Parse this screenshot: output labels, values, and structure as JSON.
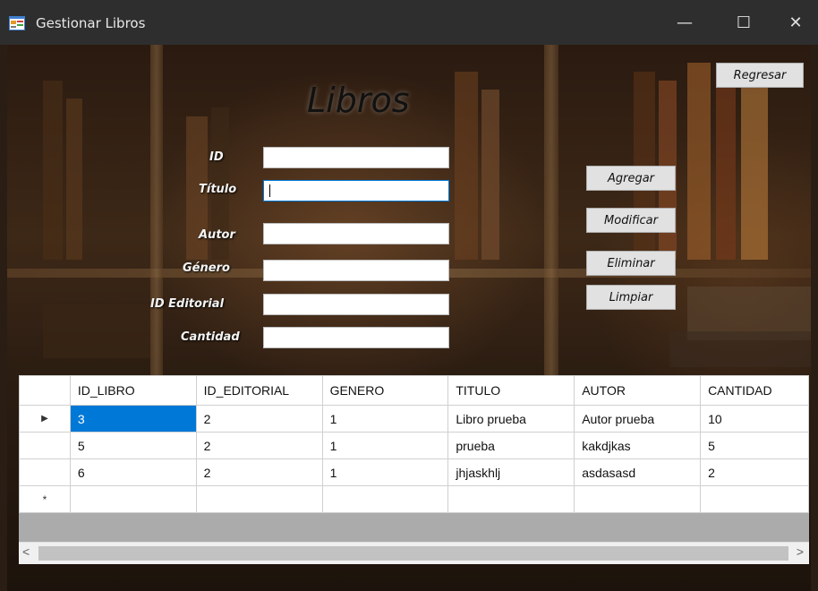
{
  "window": {
    "title": "Gestionar Libros",
    "minimize_glyph": "—",
    "maximize_glyph": "☐",
    "close_glyph": "✕"
  },
  "form": {
    "heading": "Libros",
    "back_button": "Regresar",
    "labels": {
      "id": "ID",
      "titulo": "Título",
      "autor": "Autor",
      "genero": "Género",
      "id_editorial": "ID Editorial",
      "cantidad": "Cantidad"
    },
    "values": {
      "id": "",
      "titulo": "",
      "autor": "",
      "genero": "",
      "id_editorial": "",
      "cantidad": ""
    },
    "actions": {
      "agregar": "Agregar",
      "modificar": "Modificar",
      "eliminar": "Eliminar",
      "limpiar": "Limpiar"
    }
  },
  "grid": {
    "columns": [
      "ID_LIBRO",
      "ID_EDITORIAL",
      "GENERO",
      "TITULO",
      "AUTOR",
      "CANTIDAD"
    ],
    "rows": [
      [
        "3",
        "2",
        "1",
        "Libro prueba",
        "Autor prueba",
        "10"
      ],
      [
        "5",
        "2",
        "1",
        "prueba",
        "kakdjkas",
        "5"
      ],
      [
        "6",
        "2",
        "1",
        "jhjaskhlj",
        "asdasasd",
        "2"
      ]
    ],
    "current_row_marker": "▶",
    "new_row_marker": "*",
    "scroll_left": "<",
    "scroll_right": ">"
  },
  "icons": {
    "app": "form-window-icon"
  },
  "colors": {
    "selection": "#0078d7",
    "titlebar": "#2e2e2e"
  }
}
